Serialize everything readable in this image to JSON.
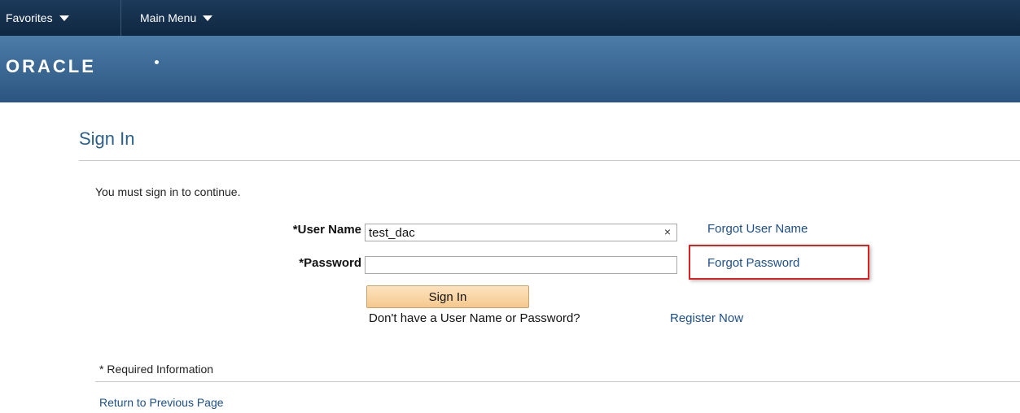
{
  "nav": {
    "favorites": "Favorites",
    "main_menu": "Main Menu"
  },
  "banner": {
    "logo": "ORACLE"
  },
  "page": {
    "title": "Sign In",
    "instruction": "You must sign in to continue."
  },
  "form": {
    "username_label": "*User Name",
    "username_value": "test_dac",
    "password_label": "*Password",
    "password_value": "",
    "clear_glyph": "×",
    "forgot_username": "Forgot User Name",
    "forgot_password": "Forgot Password",
    "signin_button": "Sign In",
    "no_account_text": "Don't have a User Name or Password?",
    "register_link": "Register Now"
  },
  "footer": {
    "required_info": "* Required Information",
    "return_link": "Return to Previous Page"
  },
  "colors": {
    "nav_bg": "#1c3a5a",
    "banner_bg": "#3b6894",
    "link": "#1d4f8a",
    "button_bg": "#f8d6a6",
    "highlight": "#e02020"
  }
}
